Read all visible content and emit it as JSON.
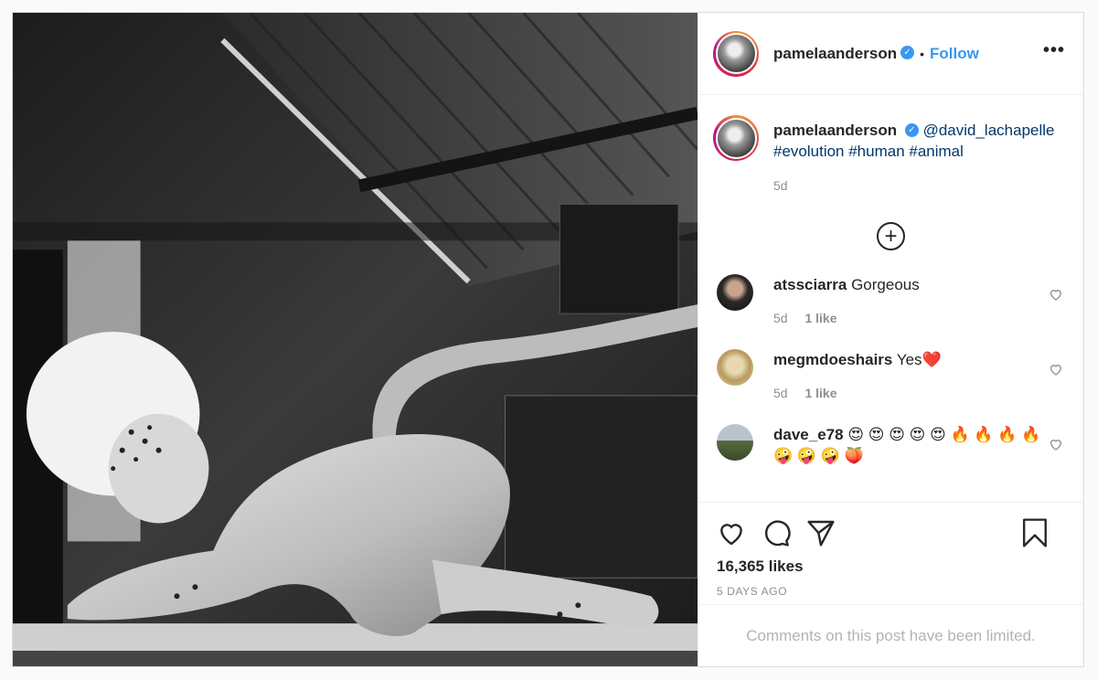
{
  "post": {
    "username": "pamelaanderson",
    "verified_mark": "✓",
    "separator": "•",
    "follow_label": "Follow",
    "more_label": "•••",
    "caption": {
      "mention": "@david_lachapelle",
      "hashtags": "#evolution #human #animal",
      "time": "5d"
    },
    "load_more_label": "+",
    "comments": [
      {
        "username": "atssciarra",
        "text": "Gorgeous",
        "time": "5d",
        "likes": "1 like"
      },
      {
        "username": "megmdoeshairs",
        "text": "Yes❤️",
        "time": "5d",
        "likes": "1 like"
      },
      {
        "username": "dave_e78",
        "text": "😍 😍 😍 😍 😍 🔥 🔥 🔥 🔥 🤪 🤪 🤪 🍑",
        "time": "",
        "likes": ""
      }
    ],
    "likes_count": "16,365 likes",
    "posted_ago": "5 DAYS AGO",
    "comments_limited": "Comments on this post have been limited."
  },
  "icons": {
    "like": "heart-icon",
    "comment": "comment-icon",
    "share": "paper-plane-icon",
    "save": "bookmark-icon",
    "comment_like": "small-heart-icon",
    "load_more": "plus-circle-icon"
  },
  "colors": {
    "link": "#00376b",
    "follow": "#3897f0",
    "muted": "#8e8e8e",
    "border": "#dbdbdb"
  }
}
